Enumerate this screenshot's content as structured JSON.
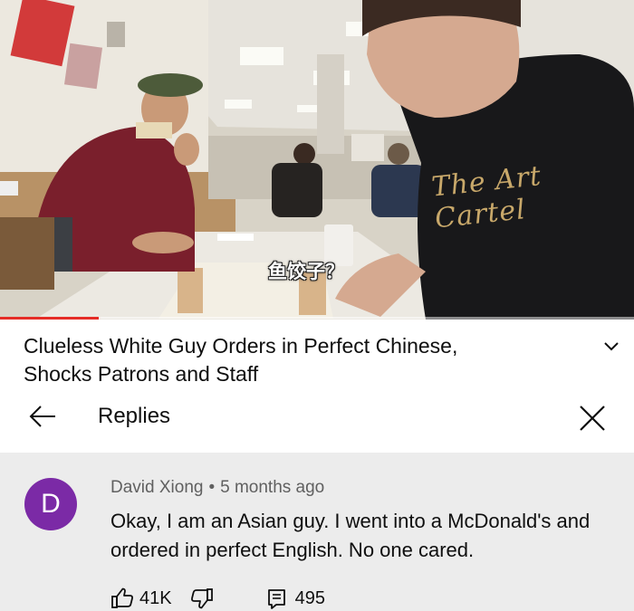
{
  "video": {
    "subtitle": "鱼饺子？",
    "shirt_text": "The Art Cartel",
    "progress_fraction": 0.155,
    "progress_color": "#e52d27"
  },
  "panel": {
    "title": "Clueless White Guy Orders in Perfect Chinese, Shocks Patrons and Staff",
    "replies_label": "Replies",
    "icons": {
      "expand": "chevron-down-icon",
      "back": "arrow-left-icon",
      "close": "close-icon"
    }
  },
  "comment": {
    "avatar_letter": "D",
    "avatar_color": "#7b2aa6",
    "author": "David Xiong",
    "separator": "•",
    "time": "5 months ago",
    "text": "Okay, I am an Asian guy. I went into a McDonald's and ordered in perfect English. No one cared.",
    "likes": "41K",
    "replies_count": "495",
    "icons": {
      "like": "thumbs-up-icon",
      "dislike": "thumbs-down-icon",
      "reply": "reply-icon"
    }
  }
}
